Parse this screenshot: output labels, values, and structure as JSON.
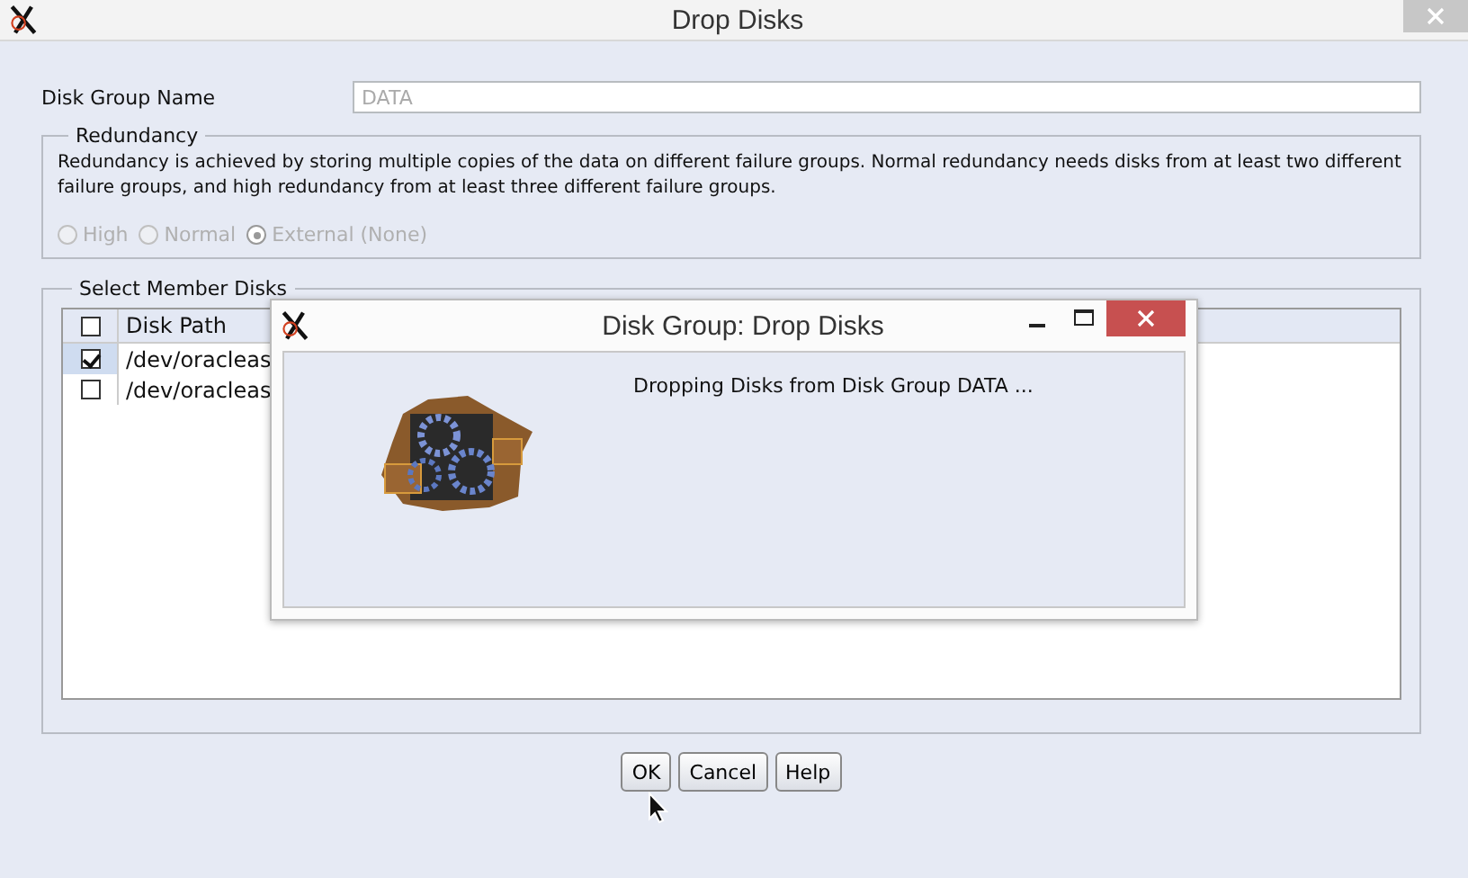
{
  "window": {
    "title": "Drop Disks"
  },
  "disk_group_name": {
    "label": "Disk Group Name",
    "value": "DATA"
  },
  "redundancy": {
    "legend": "Redundancy",
    "description": "Redundancy is achieved by storing multiple copies of the data on different failure groups. Normal redundancy needs disks from at least two different failure groups, and high redundancy from at least three different failure groups.",
    "disabled": true,
    "options": [
      {
        "label": "High",
        "selected": false
      },
      {
        "label": "Normal",
        "selected": false
      },
      {
        "label": "External (None)",
        "selected": true
      }
    ]
  },
  "member_disks": {
    "legend": "Select Member Disks",
    "columns": [
      "Disk Path"
    ],
    "header_checked": false,
    "rows": [
      {
        "path": "/dev/oracleas",
        "checked": true,
        "selected": true
      },
      {
        "path": "/dev/oracleas",
        "checked": false,
        "selected": false
      }
    ]
  },
  "buttons": [
    "OK",
    "Cancel",
    "Help"
  ],
  "progress_dialog": {
    "title": "Disk Group: Drop Disks",
    "message": "Dropping Disks from Disk Group DATA ..."
  }
}
